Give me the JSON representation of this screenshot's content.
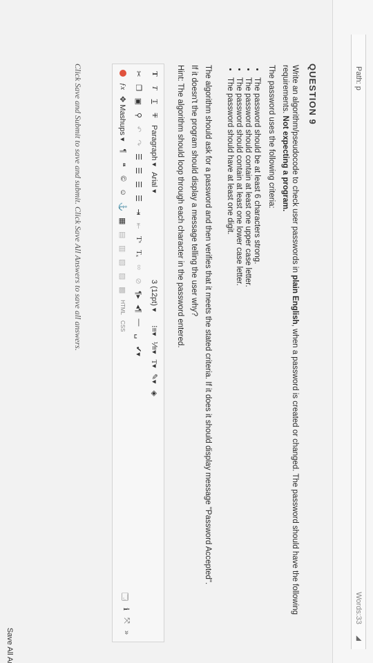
{
  "editor_bar": {
    "path": "Path: p",
    "words": "Words:33"
  },
  "question": {
    "title": "QUESTION 9",
    "intro_start": "Write an algorithm/pseudocode to check user passwords in ",
    "intro_bold": "plain English",
    "intro_mid": ", when a password is created or changed. The password should have the following requirements. ",
    "intro_bold2": "Not expecting a program.",
    "criteria_lead": "The password uses the following criteria:",
    "criteria": [
      "The password should be at least 6 characters strong.",
      "The password should contain at least one upper case letter.",
      "The password should contain at least one lower case letter.",
      "The password should have at least one digit."
    ],
    "para1": "The algorithm should ask for a password and then verifies that it meets the stated criteria. If it does it should display message \"Password Accepted\".",
    "para2": "If it doesn't the program should display a message telling the user why?",
    "hint": "Hint: The algorithm should loop through each character in the password entered."
  },
  "toolbar": {
    "paragraph": "Paragraph",
    "font": "Arial",
    "size": "3 (12pt)",
    "mashups": "Mashups",
    "html": "HTML",
    "css": "CSS"
  },
  "footer": {
    "note": "Click Save and Submit to save and submit. Click Save All Answers to save all answers.",
    "save_all": "Save All Ans"
  }
}
